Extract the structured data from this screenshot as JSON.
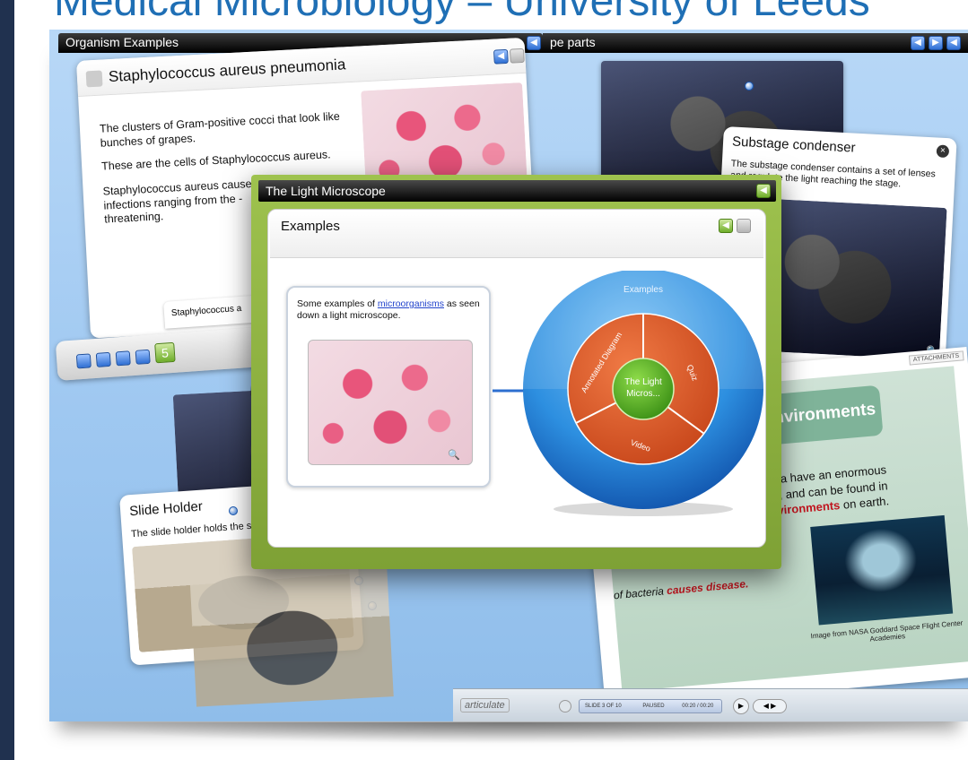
{
  "page": {
    "header_title": "Medical Microbiology – University of Leeds"
  },
  "organism_panel": {
    "bar_title": "Organism Examples",
    "card_title": "Staphylococcus aureus pneumonia",
    "paragraphs": [
      "The clusters of Gram-positive cocci that look like bunches of grapes.",
      "These are the cells of Staphylococcus aureus.",
      "Staphylococcus aureus cause infections ranging from the -threatening."
    ],
    "tab_label": "Staphylococcus a",
    "nav_active": "5"
  },
  "parts_panel": {
    "bar_title": "pe parts",
    "popup_title": "Substage condenser",
    "popup_text": "The substage condenser contains a set of lenses and regulate the light reaching the stage."
  },
  "slide_holder": {
    "title": "Slide Holder",
    "text": "The slide holder holds the s"
  },
  "bacteria_panel": {
    "heading": "me environments",
    "line1a": "eria have an enormous",
    "line2a": "es",
    "line2b": ", and can be found in",
    "line3a": "nvironments",
    "line3b": " on earth.",
    "bottom_a": "of bacteria ",
    "bottom_b": "causes disease.",
    "caption": "Image from NASA Goddard Space Flight Center Academies",
    "attachment_tab": "ATTACHMENTS"
  },
  "player_bar": {
    "logo": "articulate",
    "slide_status": "SLIDE 3 OF 10",
    "state": "PAUSED",
    "time": "00:20 / 00:20"
  },
  "light_microscope": {
    "bar_title": "The Light Microscope",
    "section_title": "Examples",
    "text_before_link": "Some examples of ",
    "link_text": "microorganisms",
    "text_after_link": " as seen down a light microscope.",
    "diagram": {
      "outer_label": "Examples",
      "segments": [
        "Annotated Diagram",
        "Quiz",
        "Video"
      ],
      "center_label_1": "The Light",
      "center_label_2": "Micros..."
    }
  },
  "colors": {
    "header_blue": "#1f6fb5",
    "frame_green": "#8db443",
    "outer_blue": "#2d8fe0",
    "segment_orange": "#e0642d",
    "center_green": "#5bb122"
  }
}
